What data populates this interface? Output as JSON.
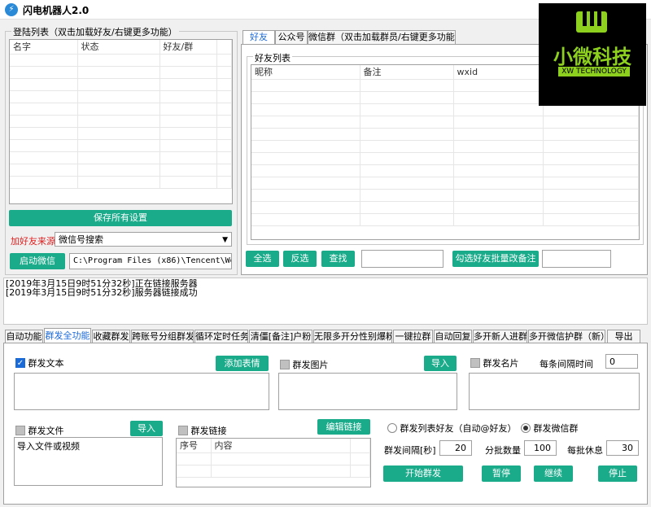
{
  "window": {
    "title": "闪电机器人2.0"
  },
  "login_group": {
    "title": "登陆列表（双击加载好友/右键更多功能）",
    "columns": [
      "名字",
      "状态",
      "好友/群"
    ],
    "save_button": "保存所有设置",
    "source_label": "加好友来源",
    "source_value": "微信号搜索",
    "start_button": "启动微信",
    "wechat_path": "C:\\Program Files (x86)\\Tencent\\WeChat"
  },
  "right_tabs": [
    "好友",
    "公众号",
    "微信群（双击加载群员/右键更多功能）"
  ],
  "friend_group": {
    "title": "好友列表",
    "columns": [
      "昵称",
      "备注",
      "wxid"
    ],
    "select_all": "全选",
    "invert": "反选",
    "find": "查找",
    "batch_remark": "勾选好友批量改备注"
  },
  "logo": {
    "name": "小微科技",
    "sub": "XW TECHNOLOGY"
  },
  "log": [
    "[2019年3月15日9时51分32秒]正在链接服务器",
    "[2019年3月15日9时51分32秒]服务器链接成功"
  ],
  "func_tabs": [
    "自动功能",
    "群发全功能",
    "收藏群发",
    "跨账号分组群发",
    "循环定时任务",
    "清僵[备注]户粉",
    "无限多开分性别爆粉",
    "一键拉群",
    "自动回复",
    "多开新人进群",
    "多开微信护群（新）",
    "导出"
  ],
  "mass": {
    "text_label": "群发文本",
    "add_emoji": "添加表情",
    "image_label": "群发图片",
    "import_image": "导入",
    "card_label": "群发名片",
    "interval_each_label": "每条间隔时间",
    "interval_each_value": "0",
    "file_label": "群发文件",
    "import_file": "导入",
    "file_hint": "导入文件或视频",
    "link_label": "群发链接",
    "edit_link": "编辑链接",
    "link_columns": [
      "序号",
      "内容"
    ],
    "radio_friends": "群发列表好友（自动@好友）",
    "radio_groups": "群发微信群",
    "interval_label": "群发间隔[秒]",
    "interval_value": "20",
    "batch_count_label": "分批数量",
    "batch_count_value": "100",
    "batch_rest_label": "每批休息",
    "batch_rest_value": "30",
    "start": "开始群发",
    "pause": "暂停",
    "resume": "继续",
    "stop": "停止"
  }
}
